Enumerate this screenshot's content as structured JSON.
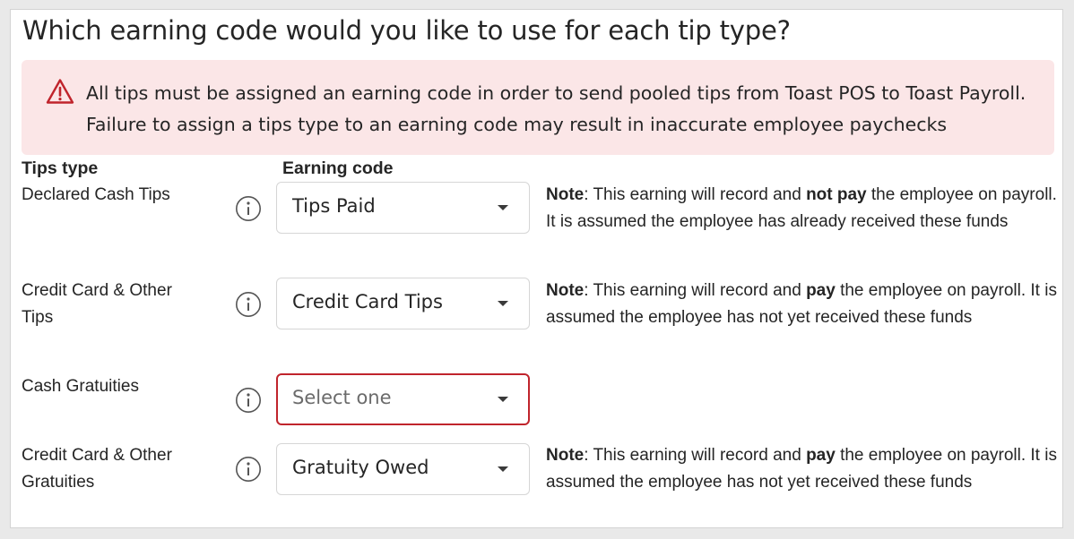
{
  "header": {
    "title": "Which earning code would you like to use for each tip type?"
  },
  "alert": {
    "icon": "warning-triangle-icon",
    "color": "#c0242c",
    "background": "#fbe6e7",
    "line1": "All tips must be assigned an earning code in order to send pooled tips from Toast POS to Toast Payroll.",
    "line2": "Failure to assign a tips type to an earning code may result in inaccurate employee paychecks"
  },
  "columns": {
    "tips_type": "Tips type",
    "earning_code": "Earning code"
  },
  "rows": [
    {
      "label": "Declared Cash Tips",
      "select_value": "Tips Paid",
      "note": {
        "prefix": "Note",
        "text1": ": This earning will record and ",
        "emphasis": "not pay",
        "text2": " the employee on payroll. It is assumed the employee has already received these funds"
      }
    },
    {
      "label": "Credit Card & Other Tips",
      "select_value": "Credit Card Tips",
      "note": {
        "prefix": "Note",
        "text1": ": This earning will record and ",
        "emphasis": "pay",
        "text2": " the employee on payroll. It is assumed the employee has not yet received these funds"
      }
    },
    {
      "label": "Cash Gratuities",
      "select_placeholder": "Select one",
      "error": true
    },
    {
      "label": "Credit Card & Other Gratuities",
      "select_value": "Gratuity Owed",
      "note": {
        "prefix": "Note",
        "text1": ": This earning will record and ",
        "emphasis": "pay",
        "text2": " the employee on payroll. It is assumed the employee has not yet received these funds"
      }
    }
  ],
  "icons": {
    "info": "info-circle-icon",
    "caret": "chevron-down-icon"
  },
  "colors": {
    "error_border": "#c0242c",
    "text": "#252525"
  }
}
